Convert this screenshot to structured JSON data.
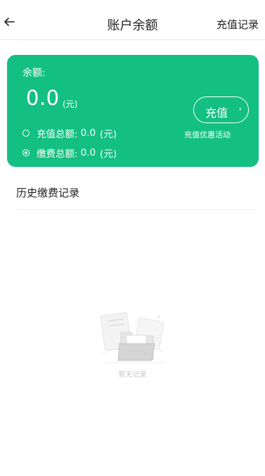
{
  "header": {
    "title": "账户余额",
    "records_link": "充值记录"
  },
  "card": {
    "balance_label": "余额:",
    "balance_value": "0.0",
    "balance_unit": "(元)",
    "recharge_total_label": "充值总额:",
    "recharge_total_value": "0.0",
    "recharge_total_unit": "(元)",
    "payment_total_label": "缴费总额:",
    "payment_total_value": "0.0",
    "payment_total_unit": "(元)",
    "recharge_button": "充值",
    "promo_link": "充值优惠活动",
    "bg_color": "#14bf84"
  },
  "history": {
    "title": "历史缴费记录",
    "empty_text": "暂无记录"
  },
  "icons": {
    "back": "arrow-left-icon",
    "chevron": "chevron-right-icon",
    "recharge_stat": "coin-icon",
    "payment_stat": "target-icon",
    "empty": "empty-folder-icon"
  }
}
